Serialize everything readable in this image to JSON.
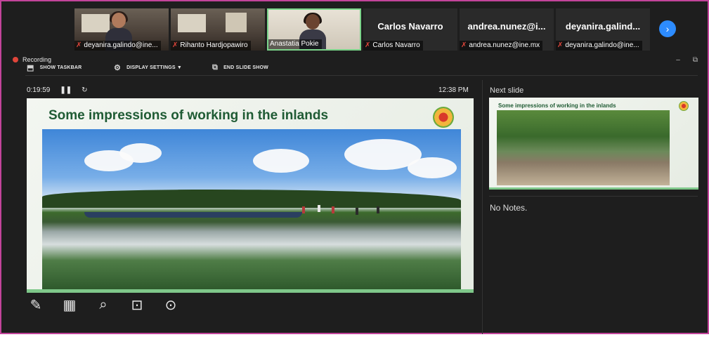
{
  "participants": [
    {
      "name": "deyanira.galindo@ine...",
      "type": "video",
      "muted": true
    },
    {
      "name": "Rihanto Hardjopawiro",
      "type": "video",
      "muted": true
    },
    {
      "name": "Anastatia Pokie",
      "type": "video",
      "muted": false,
      "active_speaker": true
    },
    {
      "name": "Carlos Navarro",
      "big_name": "Carlos Navarro",
      "type": "name",
      "muted": true
    },
    {
      "name": "andrea.nunez@ine.mx",
      "big_name": "andrea.nunez@i...",
      "type": "name",
      "muted": true
    },
    {
      "name": "deyanira.galindo@ine...",
      "big_name": "deyanira.galind...",
      "type": "name",
      "muted": true
    }
  ],
  "next_participants_icon": "chevron-right-icon",
  "recording": {
    "label": "Recording"
  },
  "toolbar": {
    "show_taskbar": "SHOW TASKBAR",
    "display_settings": "DISPLAY SETTINGS ▼",
    "end_slide_show": "END SLIDE SHOW"
  },
  "presentation": {
    "timer": "0:19:59",
    "clock": "12:38 PM",
    "slide_title": "Some impressions of working in the inlands",
    "next_slide_label": "Next slide",
    "next_slide_title": "Some impressions of working in the inlands",
    "notes": "No Notes."
  },
  "slide_controls": [
    "pen-icon",
    "see-all-slides-icon",
    "zoom-icon",
    "black-screen-icon",
    "more-options-icon"
  ],
  "colors": {
    "frame_border": "#c2449a",
    "background": "#1e1e1e",
    "accent_blue": "#2d8cff",
    "slide_title_green": "#1f5b34",
    "slide_accent_green": "#7fc88a",
    "muted_mic_red": "#e0453a"
  }
}
